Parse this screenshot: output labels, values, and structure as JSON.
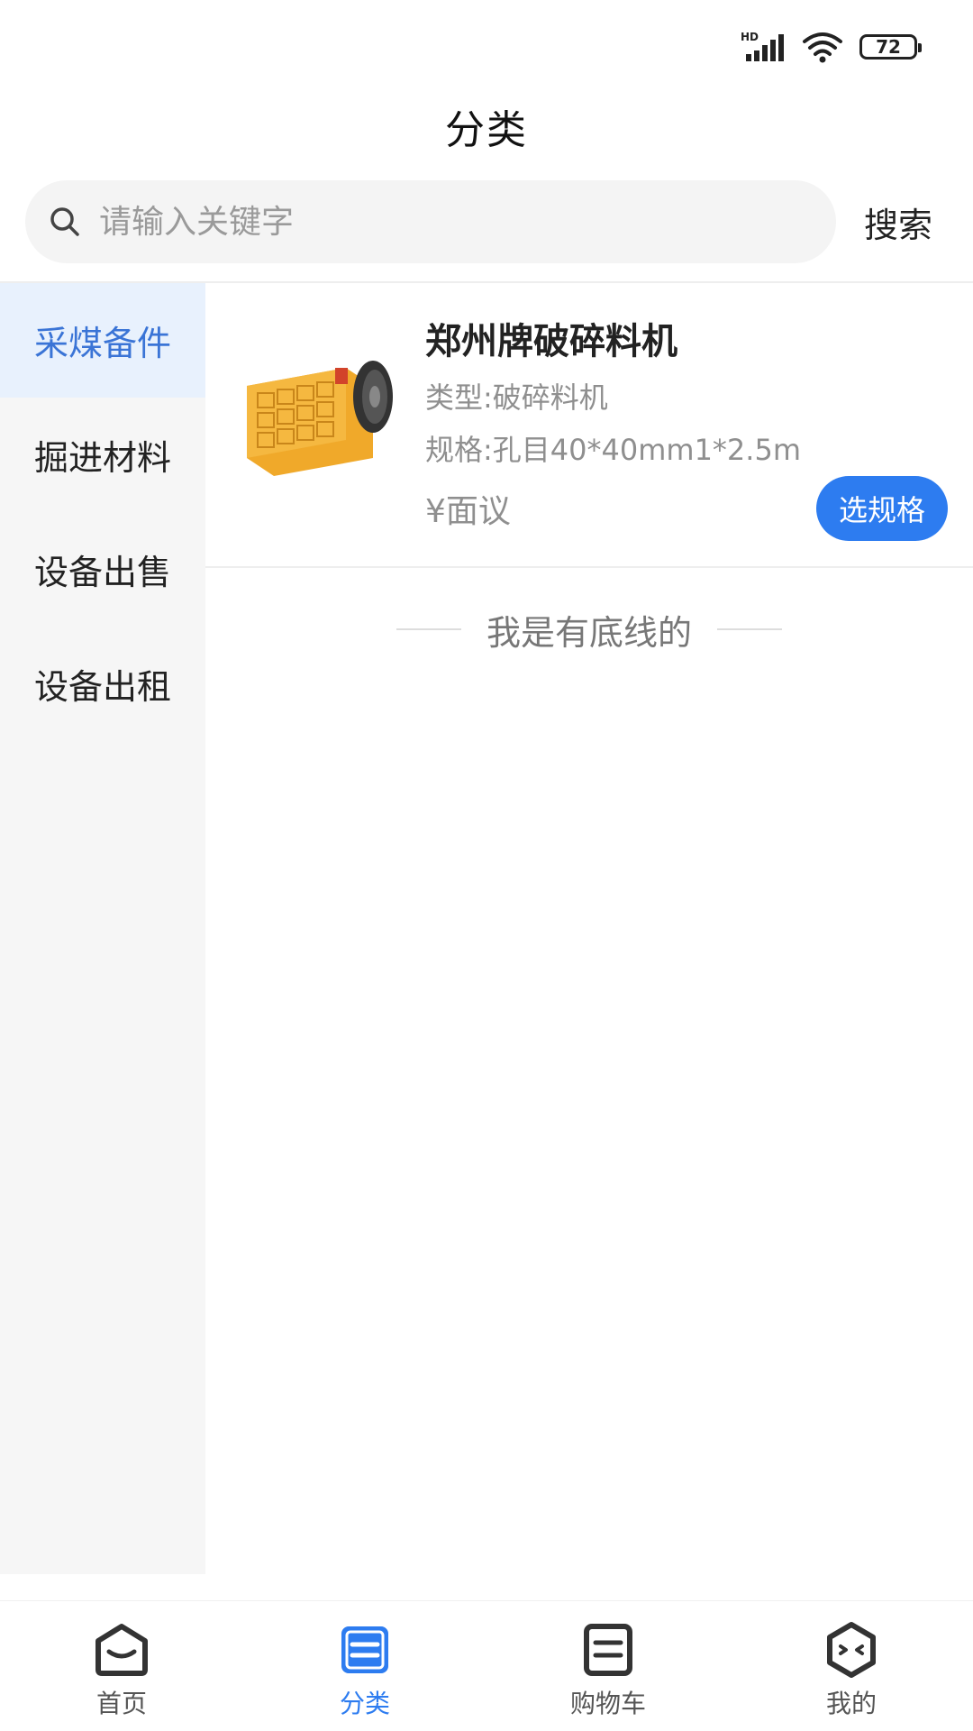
{
  "status_bar": {
    "network_label": "HD",
    "battery": "72"
  },
  "header": {
    "title": "分类"
  },
  "search": {
    "placeholder": "请输入关键字",
    "button_label": "搜索"
  },
  "sidebar": {
    "items": [
      {
        "label": "采煤备件",
        "active": true
      },
      {
        "label": "掘进材料",
        "active": false
      },
      {
        "label": "设备出售",
        "active": false
      },
      {
        "label": "设备出租",
        "active": false
      }
    ]
  },
  "products": [
    {
      "title": "郑州牌破碎料机",
      "type": "类型:破碎料机",
      "spec": "规格:孔目40*40mm1*2.5m",
      "price": "¥面议",
      "button_label": "选规格"
    }
  ],
  "list_end_text": "我是有底线的",
  "tabbar": {
    "tabs": [
      {
        "label": "首页",
        "icon": "home-icon",
        "active": false
      },
      {
        "label": "分类",
        "icon": "category-icon",
        "active": true
      },
      {
        "label": "购物车",
        "icon": "cart-icon",
        "active": false
      },
      {
        "label": "我的",
        "icon": "profile-icon",
        "active": false
      }
    ]
  },
  "colors": {
    "accent": "#2d7cf0",
    "sidebar_active_bg": "#e8f1fd",
    "sidebar_active_text": "#3a74d6"
  }
}
